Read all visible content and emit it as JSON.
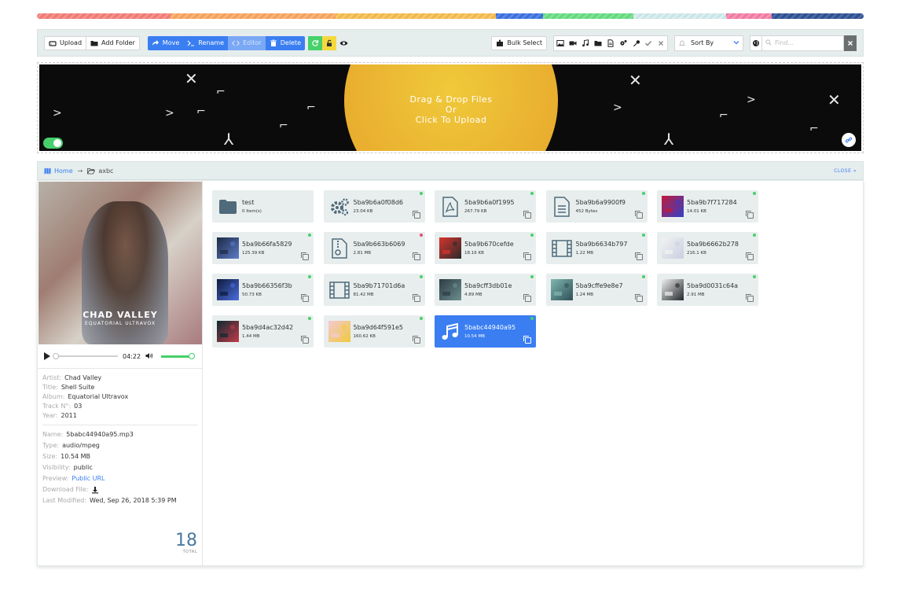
{
  "colors": {
    "accent": "#3a7ef2",
    "green": "#47d06b",
    "yellow": "#f5d93c",
    "panel_bg": "#e5eded",
    "rainbow": [
      "#ef7a73",
      "#f5a05a",
      "#f2b74a",
      "#3c6fdc",
      "#62d97e",
      "#c9e4e7",
      "#f07aa0",
      "#2f4f8f"
    ]
  },
  "toolbar": {
    "upload": "Upload",
    "add_folder": "Add Folder",
    "move": "Move",
    "rename": "Rename",
    "editor": "Editor",
    "delete": "Delete",
    "bulk_select": "Bulk Select",
    "sort_by": "Sort By",
    "search_placeholder": "Find..."
  },
  "dropzone": {
    "line1": "Drag & Drop Files",
    "line2": "Or",
    "line3": "Click To Upload"
  },
  "breadcrumb": {
    "home": "Home",
    "arrow": "→",
    "folder": "axbc",
    "close": "CLOSE"
  },
  "player": {
    "cover_artist": "CHAD VALLEY",
    "cover_album": "EQUATORIAL ULTRAVOX",
    "duration": "04:22",
    "progress": 0,
    "volume": 1
  },
  "track_meta": [
    {
      "k": "Artist:",
      "v": "Chad Valley"
    },
    {
      "k": "Title:",
      "v": "Shell Suite"
    },
    {
      "k": "Album:",
      "v": "Equatorial Ultravox"
    },
    {
      "k": "Track N°:",
      "v": "03"
    },
    {
      "k": "Year:",
      "v": "2011"
    }
  ],
  "file_meta": {
    "name_k": "Name:",
    "name_v": "5babc44940a95.mp3",
    "type_k": "Type:",
    "type_v": "audio/mpeg",
    "size_k": "Size:",
    "size_v": "10.54 MB",
    "visibility_k": "Visibility:",
    "visibility_v": "public",
    "preview_k": "Preview:",
    "preview_v": "Public URL",
    "download_k": "Download File:",
    "modified_k": "Last Modified:",
    "modified_v": "Wed, Sep 26, 2018 5:39 PM"
  },
  "total": {
    "count": "18",
    "label": "TOTAL"
  },
  "files": [
    {
      "name": "test",
      "size": "0 Item(s)",
      "icon": "folder-icon",
      "status": "none"
    },
    {
      "name": "5ba9b6a0f08d6",
      "size": "23.04 KB",
      "icon": "gears-icon",
      "status": "green"
    },
    {
      "name": "5ba9b6a0f1995",
      "size": "267.79 KB",
      "icon": "pdf-icon",
      "status": "green"
    },
    {
      "name": "5ba9b6a9900f9",
      "size": "452 Bytes",
      "icon": "document-icon",
      "status": "green"
    },
    {
      "name": "5ba9b7f717284",
      "size": "14.01 KB",
      "icon": "image-thumb",
      "status": "green",
      "thumb": [
        "#c21a3a",
        "#3340c8"
      ]
    },
    {
      "name": "5ba9b66fa5829",
      "size": "125.39 KB",
      "icon": "image-thumb",
      "status": "green",
      "thumb": [
        "#1c2a44",
        "#5d7cc9"
      ]
    },
    {
      "name": "5ba9b663b6069",
      "size": "2.81 MB",
      "icon": "zip-icon",
      "status": "red"
    },
    {
      "name": "5ba9b670cefde",
      "size": "18.16 KB",
      "icon": "image-thumb",
      "status": "green",
      "thumb": [
        "#d7332c",
        "#2b2b2b"
      ]
    },
    {
      "name": "5ba9b6634b797",
      "size": "1.22 MB",
      "icon": "film-icon",
      "status": "green"
    },
    {
      "name": "5ba9b6662b278",
      "size": "216.1 KB",
      "icon": "image-thumb",
      "status": "green",
      "thumb": [
        "#f2f2f2",
        "#c8cfe0"
      ]
    },
    {
      "name": "5ba9b66356f3b",
      "size": "50.73 KB",
      "icon": "image-thumb",
      "status": "green",
      "thumb": [
        "#0d1a3a",
        "#4b6ee0"
      ]
    },
    {
      "name": "5ba9b71701d6a",
      "size": "81.42 MB",
      "icon": "film-icon",
      "status": "green"
    },
    {
      "name": "5ba9cff3db01e",
      "size": "4.89 MB",
      "icon": "image-thumb",
      "status": "green",
      "thumb": [
        "#2d3b44",
        "#6b8f8f"
      ]
    },
    {
      "name": "5ba9cffe9e8e7",
      "size": "1.24 MB",
      "icon": "image-thumb",
      "status": "green",
      "thumb": [
        "#7fb8b0",
        "#2f4f58"
      ]
    },
    {
      "name": "5ba9d0031c64a",
      "size": "2.91 MB",
      "icon": "image-thumb",
      "status": "green",
      "thumb": [
        "#f0f0f0",
        "#23272a"
      ]
    },
    {
      "name": "5ba9d4ac32d42",
      "size": "1.44 MB",
      "icon": "image-thumb",
      "status": "green",
      "thumb": [
        "#0d2a30",
        "#c23a4a"
      ]
    },
    {
      "name": "5ba9d64f591e5",
      "size": "160.62 KB",
      "icon": "image-thumb",
      "status": "green",
      "thumb": [
        "#f4c9d4",
        "#f0c93a"
      ]
    },
    {
      "name": "5babc44940a95",
      "size": "10.54 MB",
      "icon": "music-icon",
      "status": "green",
      "selected": true
    }
  ]
}
